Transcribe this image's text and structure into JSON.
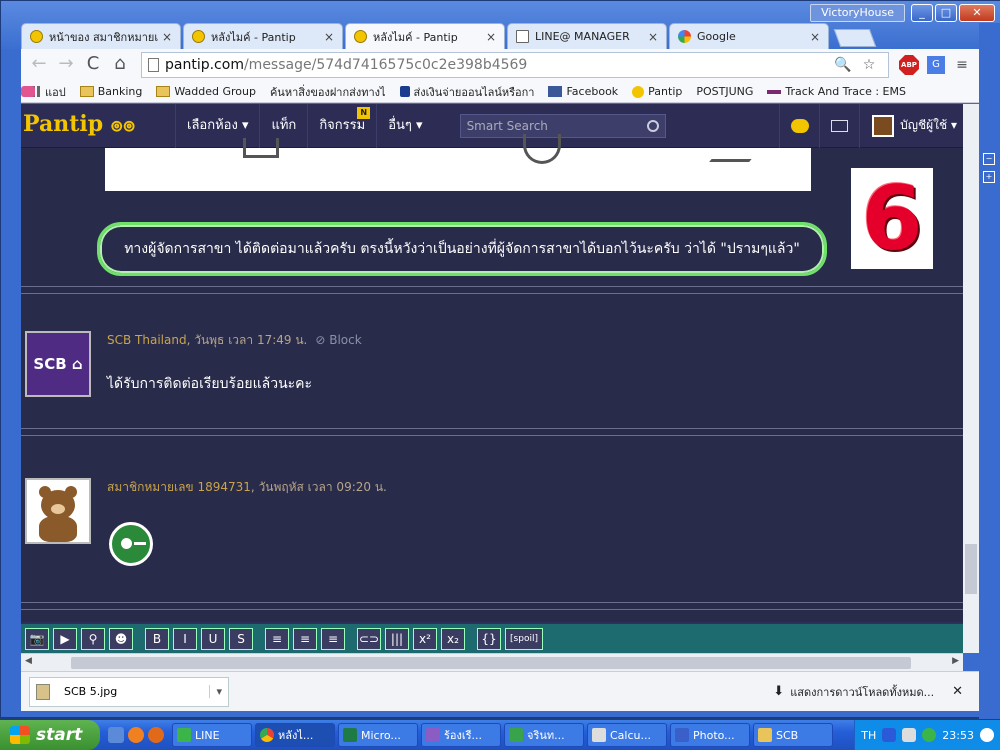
{
  "window": {
    "user": "VictoryHouse",
    "minimize": "_",
    "maximize": "□",
    "close": "✕"
  },
  "tabs": [
    {
      "label": "หน้าของ สมาชิกหมายเ",
      "close": "×",
      "icon": "pantip-icon"
    },
    {
      "label": "หลังไมค์ - Pantip",
      "close": "×",
      "icon": "pantip-icon"
    },
    {
      "label": "หลังไมค์ - Pantip",
      "close": "×",
      "icon": "pantip-icon"
    },
    {
      "label": "LINE@ MANAGER",
      "close": "×",
      "icon": "document-icon"
    },
    {
      "label": "Google",
      "close": "×",
      "icon": "google-icon"
    }
  ],
  "toolbar": {
    "back": "←",
    "forward": "→",
    "reload": "C",
    "home": "⌂",
    "url_host": "pantip.com",
    "url_path": "/message/574d7416575c0c2e398b4569",
    "zoom": "🔍",
    "star": "☆",
    "abp": "ABP",
    "translate": "G",
    "menu": "≡"
  },
  "bookmarks": [
    {
      "label": "แอป",
      "icon": "apps-icon"
    },
    {
      "label": "Banking",
      "icon": "folder-icon"
    },
    {
      "label": "Wadded Group",
      "icon": "folder-icon"
    },
    {
      "label": "ค้นหาสิ่งของฝากส่งทางไ",
      "icon": "page-icon"
    },
    {
      "label": "ส่งเงินจ่ายออนไลน์หรือกา",
      "icon": "paypal-icon"
    },
    {
      "label": "Facebook",
      "icon": "facebook-icon"
    },
    {
      "label": "Pantip",
      "icon": "pantip-icon"
    },
    {
      "label": "POSTJUNG",
      "icon": "postjung-icon"
    },
    {
      "label": "Track And Trace : EMS :",
      "icon": "ems-icon"
    }
  ],
  "pantip_nav": {
    "logo": "Pantip ၜၜ",
    "menu": [
      {
        "label": "เลือกห้อง ▾"
      },
      {
        "label": "แท็ก"
      },
      {
        "label": "กิจกรรม",
        "badge": "N"
      },
      {
        "label": "อื่นๆ ▾"
      }
    ],
    "search_placeholder": "Smart Search",
    "user_label": "บัญชีผู้ใช้ ▾"
  },
  "comment_highlight": "ทางผู้จัดการสาขา ได้ติดต่อมาแล้วครับ ตรงนี้หวังว่าเป็นอย่างที่ผู้จัดการสาขาได้บอกไว้นะครับ ว่าได้ \"ปรามๆแล้ว\"",
  "number_sticker": "6",
  "posts": [
    {
      "avatar_text": "SCB ⌂",
      "username": "SCB Thailand",
      "time": ", วันพุธ เวลา 17:49 น.",
      "block": "⊘ Block",
      "text": "ได้รับการติดต่อเรียบร้อยแล้วนะคะ"
    },
    {
      "username": "สมาชิกหมายเลข 1894731",
      "time": ", วันพฤหัส เวลา 09:20 น."
    }
  ],
  "editor_buttons": [
    "📷",
    "▶",
    "⚲",
    "☻",
    "B",
    "I",
    "U",
    "S",
    "≡",
    "≡",
    "≡",
    "⊂⊃",
    "|||",
    "x²",
    "x₂",
    "{}",
    "[spoil]"
  ],
  "download": {
    "file": "SCB 5.jpg",
    "menu": "▾",
    "show_all": "แสดงการดาวน์โหลดทั้งหมด...",
    "close": "✕"
  },
  "taskbar": {
    "start": "start",
    "buttons": [
      {
        "label": "LINE",
        "color": "#3bb44a"
      },
      {
        "label": "หลังไ...",
        "color": "#e0402a"
      },
      {
        "label": "Micro...",
        "color": "#1e7b45"
      },
      {
        "label": "ร้องเรี...",
        "color": "#8a5cc4"
      },
      {
        "label": "จรินท...",
        "color": "#38a34a"
      },
      {
        "label": "Calcu...",
        "color": "#dddddd"
      },
      {
        "label": "Photo...",
        "color": "#3a5fc8"
      },
      {
        "label": "SCB",
        "color": "#e8c45a"
      }
    ],
    "lang": "TH",
    "clock": "23:53"
  }
}
